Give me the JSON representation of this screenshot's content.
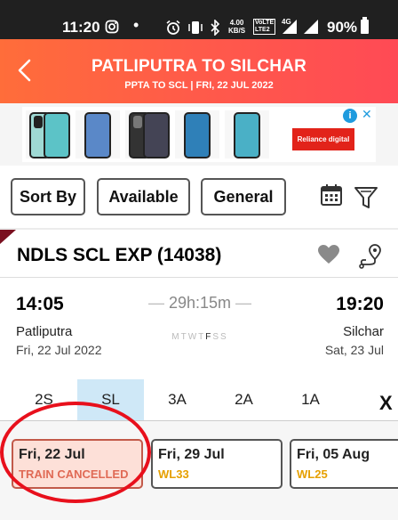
{
  "status_bar": {
    "time": "11:20",
    "speed_value": "4.00",
    "speed_unit": "KB/S",
    "volte_top": "VoLTE",
    "volte_bottom": "LTE2",
    "network": "4G",
    "battery": "90%"
  },
  "header": {
    "title": "PATLIPUTRA TO SILCHAR",
    "subtitle": "PPTA TO SCL | FRI, 22 JUL  2022",
    "gradient_start": "#ff6d3a",
    "gradient_end": "#ff4a55"
  },
  "ad": {
    "brand": "Reliance digital"
  },
  "filters": {
    "sort_label": "Sort By",
    "available_label": "Available",
    "general_label": "General"
  },
  "train": {
    "name": "NDLS SCL EXP (14038)",
    "departure": {
      "time": "14:05",
      "station": "Patliputra",
      "date": "Fri, 22 Jul  2022"
    },
    "arrival": {
      "time": "19:20",
      "station": "Silchar",
      "date": "Sat, 23 Jul"
    },
    "duration": "29h:15m",
    "days_before": "MTWT",
    "running_day": "F",
    "days_after": "SS",
    "classes": [
      "2S",
      "SL",
      "3A",
      "2A",
      "1A"
    ],
    "selected_class": "SL",
    "close_label": "X",
    "availability": [
      {
        "date": "Fri, 22 Jul",
        "status": "TRAIN CANCELLED"
      },
      {
        "date": "Fri, 29 Jul",
        "status": "WL33"
      },
      {
        "date": "Fri, 05 Aug",
        "status": "WL25"
      }
    ]
  },
  "colors": {
    "cancel": "#e06a55",
    "waitlist": "#e6a000",
    "selected_class_bg": "#cfe8f7",
    "highlight": "#e8101c"
  }
}
